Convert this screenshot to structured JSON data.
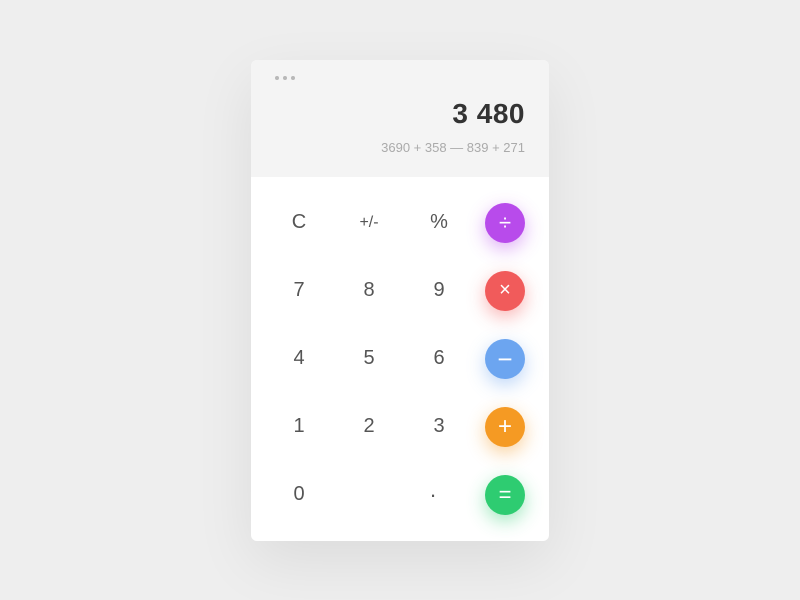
{
  "display": {
    "result": "3 480",
    "expression": "3690 + 358 — 839 + 271"
  },
  "keys": {
    "clear": "C",
    "sign": "+/-",
    "percent": "%",
    "divide": "÷",
    "seven": "7",
    "eight": "8",
    "nine": "9",
    "multiply": "×",
    "four": "4",
    "five": "5",
    "six": "6",
    "minus": "−",
    "one": "1",
    "two": "2",
    "three": "3",
    "plus": "+",
    "zero": "0",
    "dot": "·",
    "equals": "="
  },
  "colors": {
    "divide": "#b84beb",
    "multiply": "#f15b5b",
    "minus": "#6ca5f0",
    "plus": "#f59a23",
    "equals": "#2ecc71"
  }
}
